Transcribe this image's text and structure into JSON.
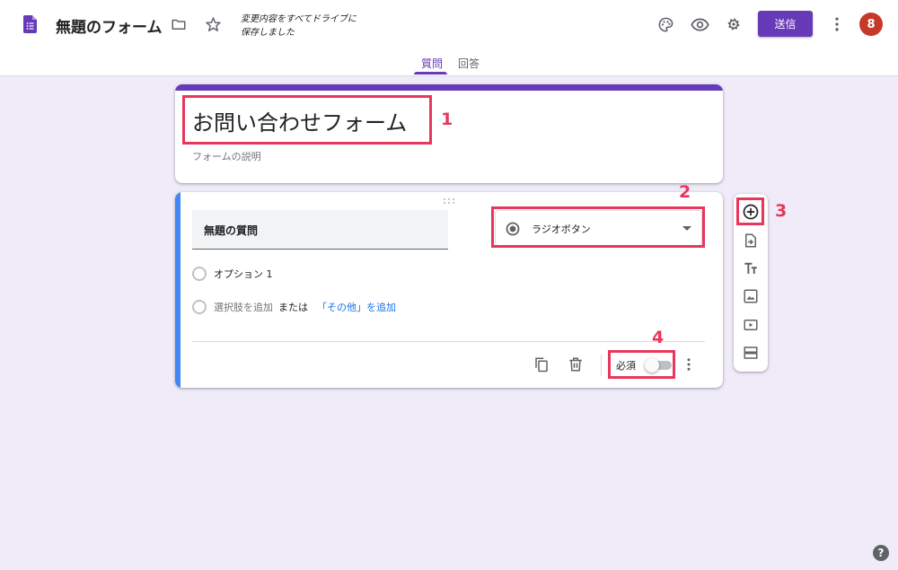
{
  "header": {
    "doc_title": "無題のフォーム",
    "save_status": "変更内容をすべてドライブに保存しました",
    "send_label": "送信",
    "avatar_initial": "8",
    "icons": [
      "forms-logo-icon",
      "folder-icon",
      "star-icon",
      "palette-icon",
      "eye-icon",
      "gear-icon",
      "more-vert-icon"
    ],
    "colors": {
      "accent": "#673ab7",
      "avatar": "#c53929",
      "background": "#f0ebf8"
    }
  },
  "tabs": [
    {
      "label": "質問",
      "active": true
    },
    {
      "label": "回答",
      "active": false
    }
  ],
  "form": {
    "title": "お問い合わせフォーム",
    "description_placeholder": "フォームの説明"
  },
  "question": {
    "title": "無題の質問",
    "type": "ラジオボタン",
    "options": [
      "オプション 1"
    ],
    "add_option_label": "選択肢を追加",
    "or_label": "または",
    "add_other_label": "「その他」を追加",
    "required_label": "必須",
    "required": false,
    "highlight_color": "#4285f4"
  },
  "side_toolbar": [
    "add-question-icon",
    "import-question-icon",
    "add-title-icon",
    "add-image-icon",
    "add-video-icon",
    "add-section-icon"
  ],
  "annotations": [
    "1",
    "2",
    "3",
    "4"
  ],
  "help_label": "?"
}
